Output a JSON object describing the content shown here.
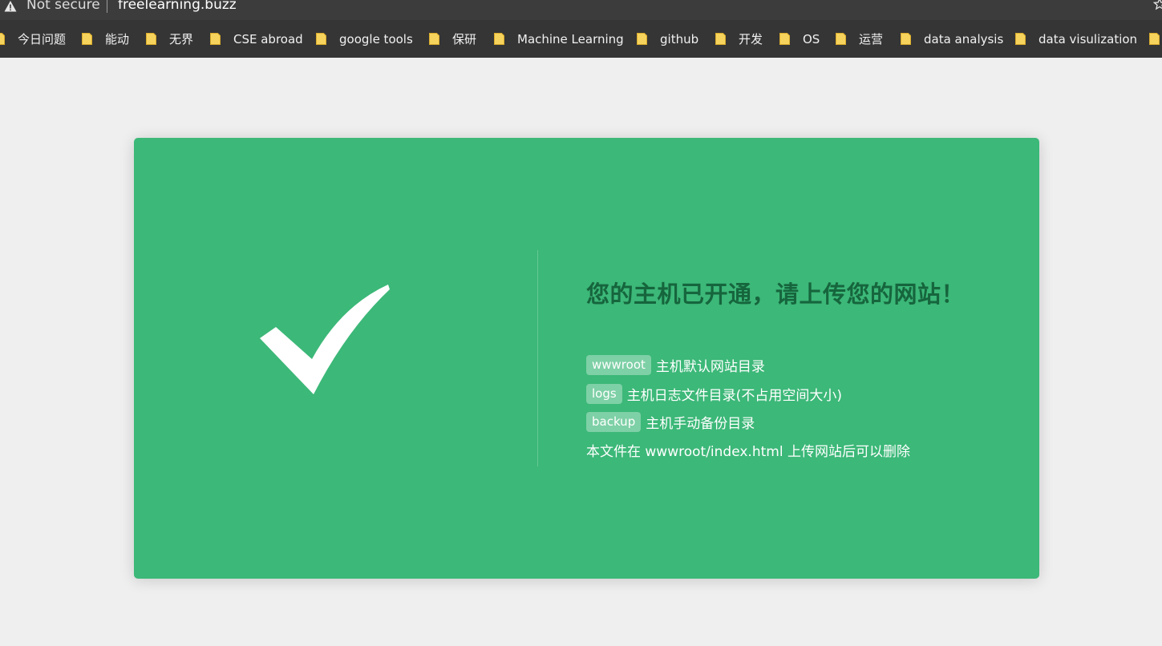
{
  "browser": {
    "security_label": "Not secure",
    "url": "freelearning.buzz"
  },
  "bookmarks": [
    {
      "label": "今日问题"
    },
    {
      "label": "能动"
    },
    {
      "label": "无界"
    },
    {
      "label": "CSE abroad"
    },
    {
      "label": "google tools"
    },
    {
      "label": "保研"
    },
    {
      "label": "Machine Learning"
    },
    {
      "label": "github"
    },
    {
      "label": "开发"
    },
    {
      "label": "OS"
    },
    {
      "label": "运营"
    },
    {
      "label": "data analysis"
    },
    {
      "label": "data visulization"
    }
  ],
  "page": {
    "headline": "您的主机已开通，请上传您的网站！",
    "items": [
      {
        "tag": "wwwroot",
        "text": "主机默认网站目录"
      },
      {
        "tag": "logs",
        "text": "主机日志文件目录(不占用空间大小)"
      },
      {
        "tag": "backup",
        "text": "主机手动备份目录"
      }
    ],
    "note": "本文件在 wwwroot/index.html 上传网站后可以删除"
  },
  "colors": {
    "card_green": "#3cb878",
    "headline_green": "#16653d",
    "folder_yellow": "#f6d35c"
  }
}
